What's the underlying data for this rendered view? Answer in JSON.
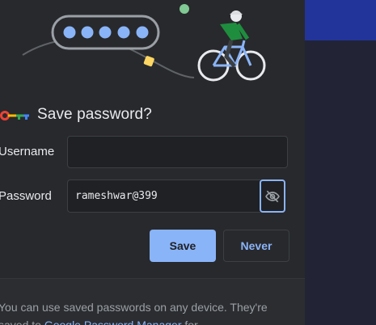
{
  "dialog": {
    "title": "Save password?",
    "username_label": "Username",
    "username_value": "",
    "password_label": "Password",
    "password_value": "rameshwar@399",
    "save_label": "Save",
    "never_label": "Never",
    "footer_text_before": "You can use saved passwords on any device. They're saved to ",
    "footer_link": "Google Password Manager",
    "footer_text_after": " for"
  },
  "icons": {
    "key": "key-icon",
    "visibility_toggle": "eye-off-icon",
    "illustration": "password-cyclist-illustration"
  },
  "colors": {
    "accent": "#8ab4f8",
    "dialog_bg": "#28292c",
    "footer_bg": "#2c2d31",
    "page_topbar": "#22349a"
  }
}
